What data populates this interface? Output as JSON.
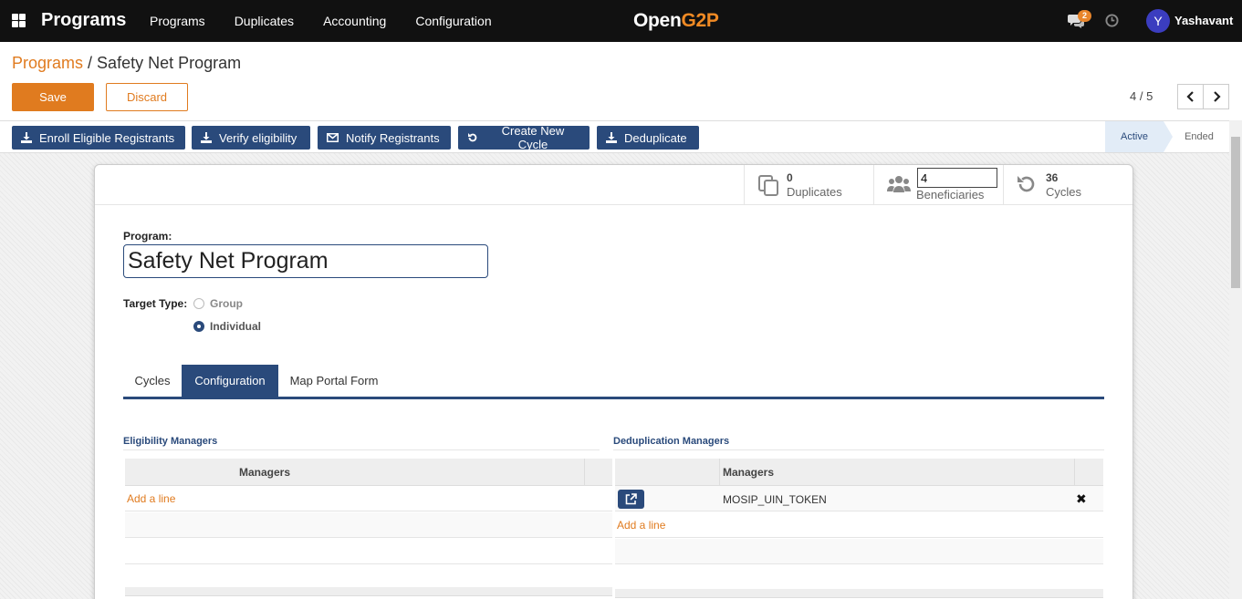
{
  "navbar": {
    "app_title": "Programs",
    "menu": [
      "Programs",
      "Duplicates",
      "Accounting",
      "Configuration"
    ],
    "logo_main": "Open",
    "logo_accent": "G2P",
    "notification_count": "2",
    "user_initial": "Y",
    "user_name": "Yashavant"
  },
  "breadcrumb": {
    "parent": "Programs",
    "separator": " / ",
    "current": "Safety Net Program"
  },
  "controls": {
    "save_label": "Save",
    "discard_label": "Discard",
    "pager": "4 / 5"
  },
  "actions": {
    "enroll": "Enroll Eligible Registrants",
    "verify": "Verify eligibility",
    "notify": "Notify Registrants",
    "new_cycle": "Create New Cycle",
    "deduplicate": "Deduplicate"
  },
  "stages": {
    "active": "Active",
    "ended": "Ended"
  },
  "smart_buttons": {
    "duplicates": {
      "value": "0",
      "label": "Duplicates"
    },
    "beneficiaries": {
      "value": "4",
      "label": "Beneficiaries"
    },
    "cycles": {
      "value": "36",
      "label": "Cycles"
    }
  },
  "form": {
    "program_label": "Program:",
    "program_name": "Safety Net Program",
    "target_type_label": "Target Type:",
    "target_options": [
      "Group",
      "Individual"
    ],
    "target_selected": "Individual"
  },
  "tabs": [
    "Cycles",
    "Configuration",
    "Map Portal Form"
  ],
  "active_tab": "Configuration",
  "eligibility": {
    "title": "Eligibility Managers",
    "column": "Managers",
    "add_line": "Add a line"
  },
  "deduplication": {
    "title": "Deduplication Managers",
    "column": "Managers",
    "rows": [
      "MOSIP_UIN_TOKEN"
    ],
    "add_line": "Add a line"
  },
  "colors": {
    "primary": "#2a4a7b",
    "accent": "#e07b1f",
    "navbar": "#111111"
  },
  "icons": [
    "apps-grid-icon",
    "chat-icon",
    "clock-icon",
    "chevron-left-icon",
    "chevron-right-icon",
    "download-icon",
    "envelope-icon",
    "refresh-icon",
    "copy-icon",
    "users-icon",
    "external-link-icon",
    "close-icon"
  ]
}
